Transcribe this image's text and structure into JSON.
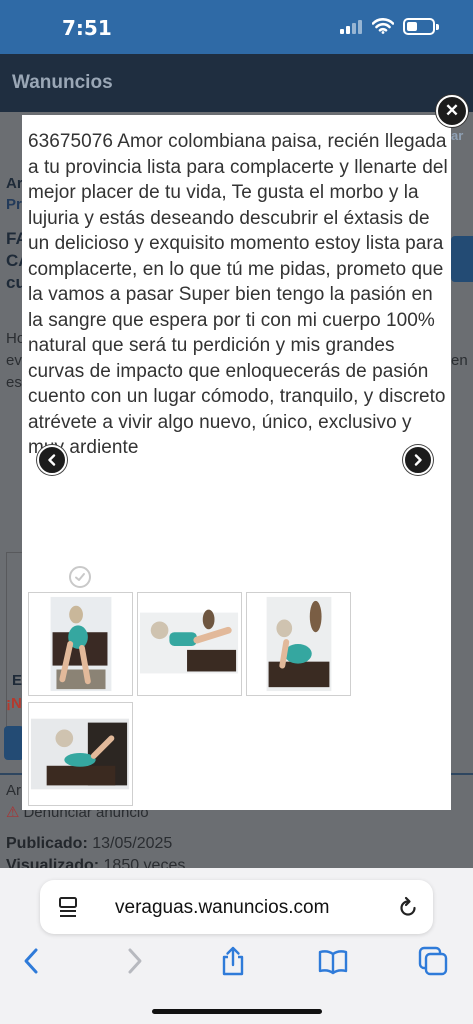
{
  "status_bar": {
    "time": "7:51"
  },
  "site": {
    "title": "Wanuncios",
    "fragments": {
      "a1": "Ar",
      "a2": "Pr",
      "fa": "FA",
      "ca": "CA",
      "cu": "cu",
      "ho": "Ho",
      "ev": "ev",
      "es": "es",
      "ar_right": "ar",
      "en_right": "en",
      "e_label": "E",
      "excl": "¡N",
      "ar2": "Ar"
    },
    "report_link": "Denunciar anuncio",
    "published_label": "Publicado:",
    "published_value": "13/05/2025",
    "viewed_label": "Visualizado:",
    "viewed_value": "1850 veces"
  },
  "modal": {
    "description": "63675076 Amor colombiana paisa, recién llegada a tu provincia lista para complacerte y llenarte del mejor placer de tu vida, Te gusta el morbo y la lujuria y estás deseando descubrir el éxtasis de un delicioso y exquisito momento estoy lista para complacerte, en lo que tú me pidas, prometo que la vamos a pasar Super bien tengo la pasión en la sangre que espera por ti con mi cuerpo 100% natural que será tu perdición y mis grandes curvas de impacto que enloquecerás de pasión cuento con un lugar cómodo, tranquilo, y discreto atrévete a vivir algo nuevo, único, exclusivo y muy ardiente",
    "close_symbol": "✕",
    "thumbnails": [
      {
        "name": "photo-1"
      },
      {
        "name": "photo-2"
      },
      {
        "name": "photo-3"
      },
      {
        "name": "photo-4"
      }
    ]
  },
  "browser": {
    "url": "veraguas.wanuncios.com"
  },
  "icons": {
    "back": "chevron-left-icon",
    "forward": "chevron-right-icon",
    "share": "share-icon",
    "bookmarks": "book-icon",
    "tabs": "tabs-icon"
  },
  "colors": {
    "accent": "#2f7bd9",
    "status_bar": "#2f6aa6",
    "header": "#1f2e40"
  }
}
